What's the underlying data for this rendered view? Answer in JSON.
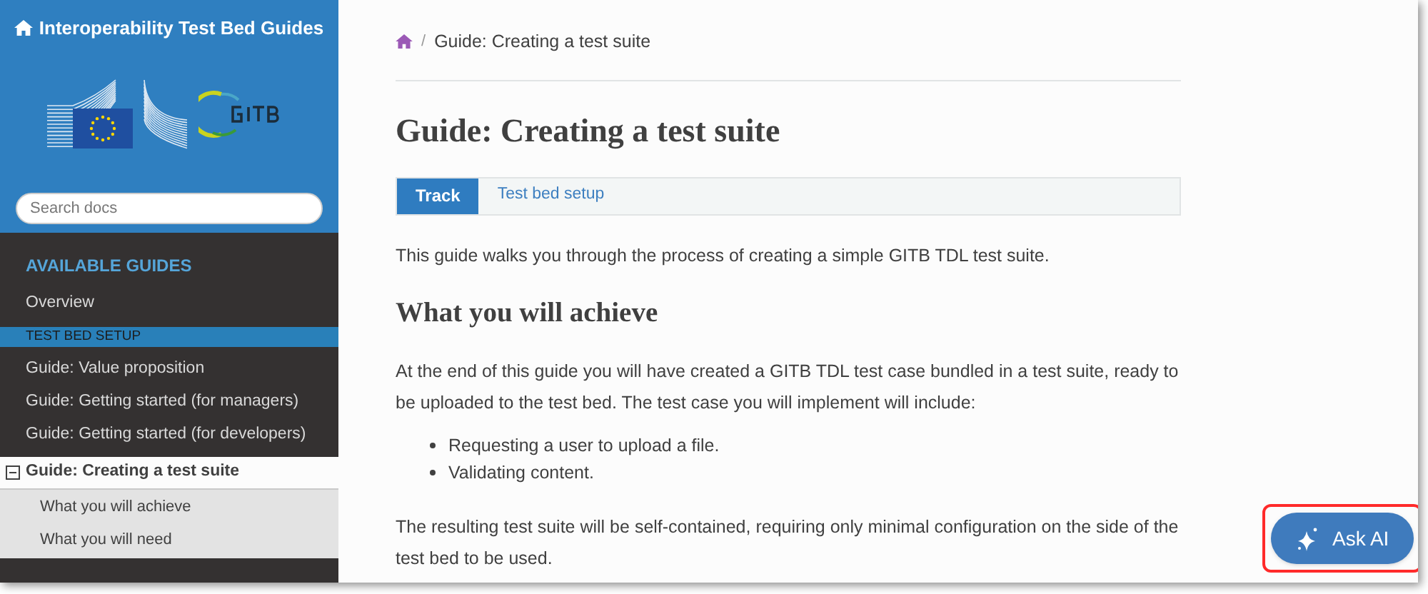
{
  "sidebar": {
    "title": "Interoperability Test Bed Guides",
    "search": {
      "placeholder": "Search docs"
    },
    "sections": [
      {
        "caption": "AVAILABLE GUIDES",
        "kind": "caption",
        "items": [
          {
            "label": "Overview",
            "selected": false
          }
        ]
      },
      {
        "caption": "TEST BED SETUP",
        "kind": "band",
        "items": [
          {
            "label": "Guide: Value proposition",
            "selected": false
          },
          {
            "label": "Guide: Getting started (for managers)",
            "selected": false
          },
          {
            "label": "Guide: Getting started (for developers)",
            "selected": false
          },
          {
            "label": "Guide: Creating a test suite",
            "selected": true,
            "expanded": true,
            "children": [
              {
                "label": "What you will achieve"
              },
              {
                "label": "What you will need"
              }
            ]
          }
        ]
      }
    ]
  },
  "breadcrumb_separator": "/",
  "breadcrumb": [
    "Guide: Creating a test suite"
  ],
  "title": "Guide: Creating a test suite",
  "tabs": [
    {
      "label": "Track",
      "selected": true
    },
    {
      "label": "Test bed setup",
      "selected": false
    }
  ],
  "content": [
    {
      "kind": "p",
      "text": "This guide walks you through the process of creating a simple GITB TDL test suite."
    },
    {
      "kind": "h2",
      "text": "What you will achieve"
    },
    {
      "kind": "p",
      "text": "At the end of this guide you will have created a GITB TDL test case bundled in a test suite, ready to be uploaded to the test bed. The test case you will implement will include:"
    },
    {
      "kind": "ul",
      "items": [
        "Requesting a user to upload a file.",
        "Validating content."
      ]
    },
    {
      "kind": "p",
      "text": "The resulting test suite will be self-contained, requiring only minimal configuration on the side of the test bed to be used."
    }
  ],
  "ask_button": {
    "label": "Ask AI"
  }
}
